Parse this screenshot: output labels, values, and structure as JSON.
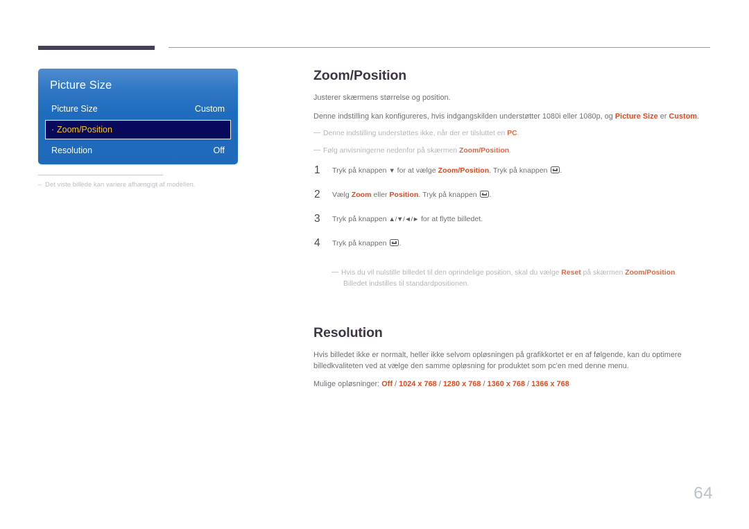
{
  "page": {
    "number": "64",
    "accent_color": "#463f52",
    "highlight_color": "#e0491f",
    "heading_color": "#3e3646",
    "body_color": "#6e6e76",
    "note_color": "#b4b4bd"
  },
  "osd": {
    "panel_title": "Picture Size",
    "rows": [
      {
        "label": "Picture Size",
        "value": "Custom",
        "selected": false,
        "bullet": ""
      },
      {
        "label": "Zoom/Position",
        "value": "",
        "selected": true,
        "bullet": "·"
      },
      {
        "label": "Resolution",
        "value": "Off",
        "selected": false,
        "bullet": ""
      }
    ],
    "caption_dash": "–",
    "caption": "Det viste billede kan variere afhængigt af modellen."
  },
  "content": {
    "zoom_position": {
      "heading": "Zoom/Position",
      "intro": "Justerer skærmens størrelse og position.",
      "paragraph_2": {
        "part_1": "Denne indstilling kan konfigureres, hvis indgangskilden understøtter 1080i eller 1080p, og ",
        "bold_1": "Picture Size",
        "part_2": " er ",
        "bold_2": "Custom",
        "part_3": "."
      },
      "note_1": {
        "lead": "—",
        "part_1": "Denne indstilling understøttes ikke, når der er tilsluttet en ",
        "bold_1": "PC",
        "part_2": "."
      },
      "note_2": {
        "lead": "—",
        "part_1": "Følg anvisningerne nedenfor på skærmen ",
        "bold_1": "Zoom/Position",
        "part_2": "."
      },
      "steps": [
        {
          "number": "1",
          "part_1": "Tryk på knappen ",
          "arrow_1": "▼",
          "part_2": " for at vælge ",
          "bold_1": "Zoom/Position",
          "part_3": ". Tryk på knappen ",
          "key_icon": "enter-key-icon",
          "part_4": "."
        },
        {
          "number": "2",
          "part_1": "Vælg ",
          "bold_1": "Zoom",
          "part_2": " eller ",
          "bold_2": "Position",
          "part_3": ". Tryk på knappen ",
          "key_icon": "enter-key-icon",
          "part_4": "."
        },
        {
          "number": "3",
          "part_1": "Tryk på knappen ",
          "arrows": "▲/▼/◄/►",
          "part_2": " for at flytte billedet."
        },
        {
          "number": "4",
          "part_1": "Tryk på knappen ",
          "key_icon": "enter-key-icon",
          "part_2": "."
        }
      ],
      "note_3": {
        "lead": "—",
        "part_1": "Hvis du vil nulstille billedet til den oprindelige position, skal du vælge ",
        "bold_1": "Reset",
        "part_2": " på skærmen ",
        "bold_2": "Zoom/Position",
        "part_3": ".",
        "line_2": "Billedet indstilles til standardpositionen."
      }
    },
    "resolution": {
      "heading": "Resolution",
      "paragraph": "Hvis billedet ikke er normalt, heller ikke selvom opløsningen på grafikkortet er en af følgende, kan du optimere billedkvaliteten ved at vælge den samme opløsning for produktet som pc'en med denne menu.",
      "options_label": "Mulige opløsninger: ",
      "options": [
        "Off",
        "1024 x 768",
        "1280 x 768",
        "1360 x 768",
        "1366 x 768"
      ],
      "options_separator": " / "
    }
  }
}
